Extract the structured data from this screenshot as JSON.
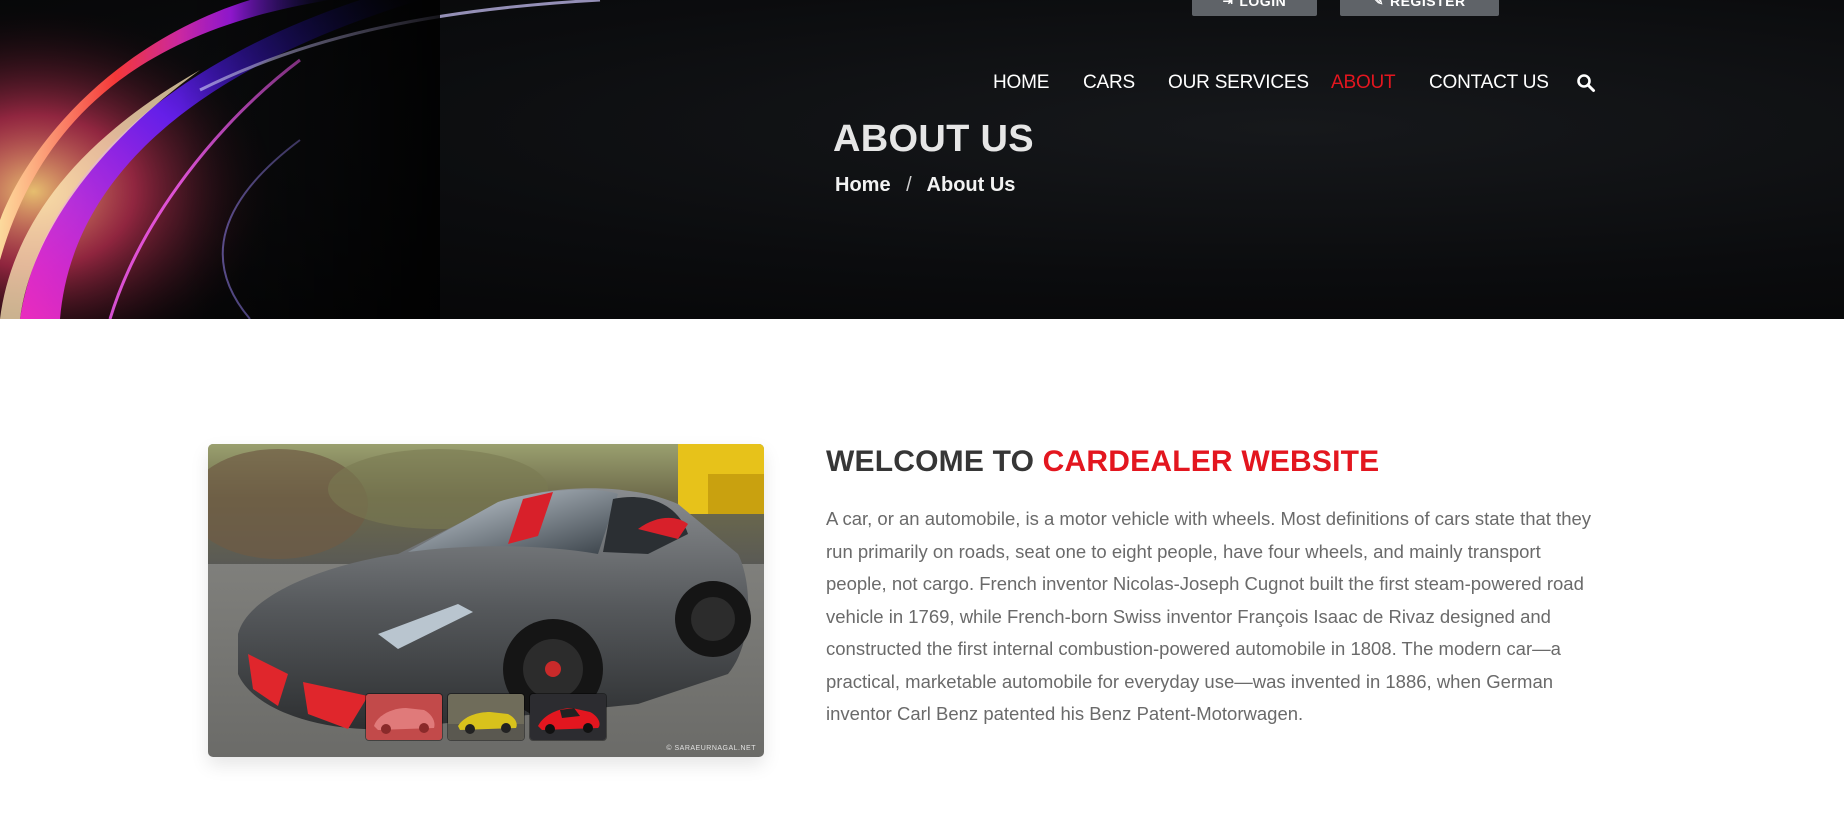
{
  "header": {
    "login_label": "LOGIN",
    "register_label": "REGISTER",
    "login_icon": "sign-in-icon",
    "register_icon": "edit-icon"
  },
  "nav": {
    "items": [
      {
        "label": "HOME"
      },
      {
        "label": "CARS"
      },
      {
        "label": "OUR SERVICES"
      },
      {
        "label": "ABOUT",
        "active": true
      },
      {
        "label": "CONTACT US"
      }
    ],
    "search_icon": "search-icon"
  },
  "hero": {
    "title": "ABOUT US",
    "breadcrumb": [
      "Home",
      "About Us"
    ],
    "breadcrumb_separator": "/"
  },
  "about": {
    "heading_prefix": "WELCOME TO",
    "heading_highlight": "CARDEALER WEBSITE",
    "paragraph": "A car, or an automobile, is a motor vehicle with wheels. Most definitions of cars state that they run primarily on roads, seat one to eight people, have four wheels, and mainly transport people, not cargo. French inventor Nicolas-Joseph Cugnot built the first steam-powered road vehicle in 1769, while French-born Swiss inventor François Isaac de Rivaz designed and constructed the first internal combustion-powered automobile in 1808. The modern car—a practical, marketable automobile for everyday use—was invented in 1886, when German inventor Carl Benz patented his Benz Patent-Motorwagen.",
    "image_watermark": "© SARAEURNAGAL.NET",
    "thumbnails": [
      "red-car-thumbnail",
      "yellow-car-thumbnail",
      "red-sports-car-thumbnail"
    ]
  },
  "colors": {
    "accent": "#e3161f",
    "hero_bg": "#0b0c0e",
    "button_bg": "#5f6368",
    "heading": "#363636",
    "body_text": "#6a6a6a"
  }
}
